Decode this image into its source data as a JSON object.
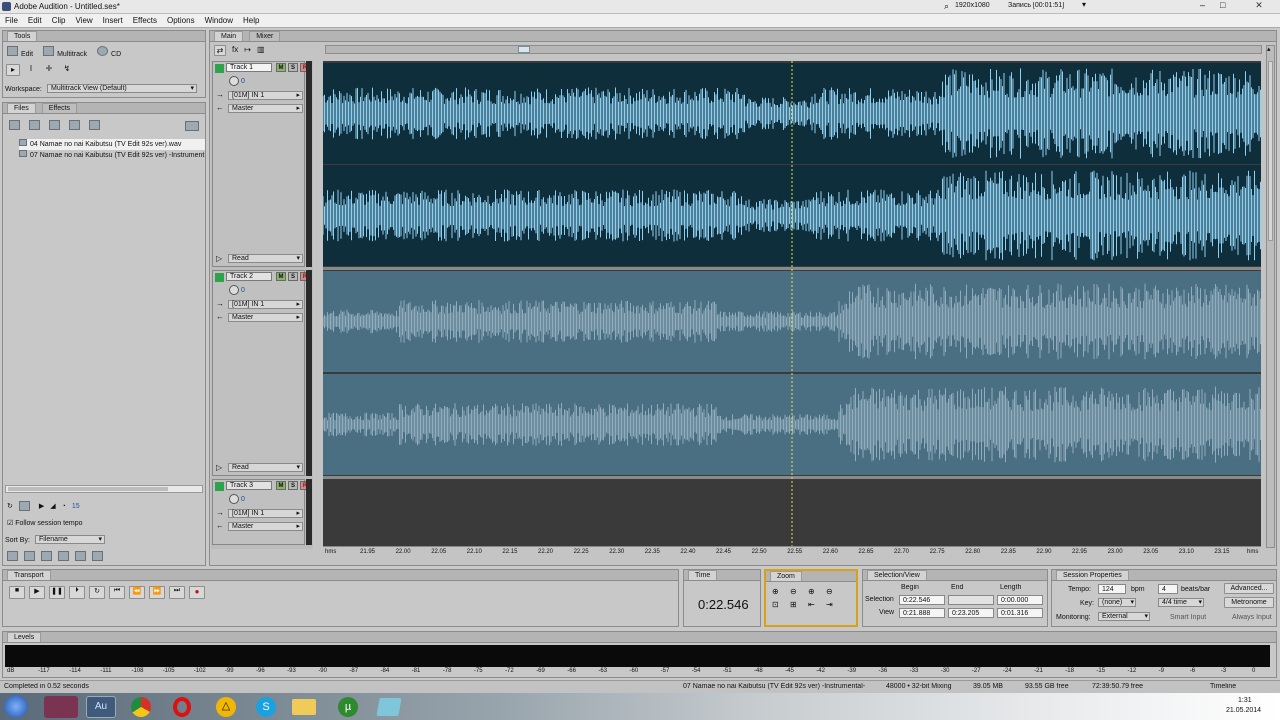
{
  "window": {
    "title": "Adobe Audition - Untitled.ses*",
    "resolution": "1920x1080",
    "record": "Запись [00:01:51]"
  },
  "menu": [
    "File",
    "Edit",
    "Clip",
    "View",
    "Insert",
    "Effects",
    "Options",
    "Window",
    "Help"
  ],
  "tools": {
    "tab": "Tools",
    "edit": "Edit",
    "multitrack": "Multitrack",
    "cd": "CD",
    "workspace_label": "Workspace:",
    "workspace_value": "Multitrack View (Default)"
  },
  "files": {
    "tab_files": "Files",
    "tab_effects": "Effects",
    "items": [
      "04 Namae no nai Kaibutsu (TV Edit 92s ver).wav",
      "07 Namae no nai Kaibutsu (TV Edit 92s ver) -Instrument"
    ],
    "follow": "Follow session tempo",
    "sortby_label": "Sort By:",
    "sortby_value": "Filename",
    "counter": "15"
  },
  "main_tabs": [
    "Main",
    "Mixer"
  ],
  "tracks": [
    {
      "name": "Track 1",
      "vol": "0",
      "input": "[01M] IN 1",
      "output": "Master",
      "mode": "Read"
    },
    {
      "name": "Track 2",
      "vol": "0",
      "input": "[01M] IN 1",
      "output": "Master",
      "mode": "Read"
    },
    {
      "name": "Track 3",
      "vol": "0",
      "input": "[01M] IN 1",
      "output": "Master",
      "mode": ""
    }
  ],
  "msr": [
    "M",
    "S",
    "R"
  ],
  "ruler": {
    "unit": "hms",
    "ticks": [
      "21.95",
      "22.00",
      "22.05",
      "22.10",
      "22.15",
      "22.20",
      "22.25",
      "22.30",
      "22.35",
      "22.40",
      "22.45",
      "22.50",
      "22.55",
      "22.60",
      "22.65",
      "22.70",
      "22.75",
      "22.80",
      "22.85",
      "22.90",
      "22.95",
      "23.00",
      "23.05",
      "23.10",
      "23.15"
    ],
    "end": "hms"
  },
  "transport": {
    "tab": "Transport"
  },
  "time": {
    "tab": "Time",
    "value": "0:22.546"
  },
  "zoom": {
    "tab": "Zoom"
  },
  "selview": {
    "tab": "Selection/View",
    "begin": "Begin",
    "end": "End",
    "length": "Length",
    "sel_label": "Selection",
    "sel_begin": "0:22.546",
    "sel_end": "",
    "sel_length": "0:00.000",
    "view_label": "View",
    "view_begin": "0:21.888",
    "view_end": "0:23.205",
    "view_length": "0:01.316"
  },
  "session": {
    "tab": "Session Properties",
    "tempo_label": "Tempo:",
    "tempo": "124",
    "bpm": "bpm",
    "beats": "4",
    "beats_label": "beats/bar",
    "advanced": "Advanced...",
    "key_label": "Key:",
    "key": "(none)",
    "time_sig": "4/4 time",
    "metronome": "Metronome",
    "monitoring_label": "Monitoring:",
    "monitoring": "External",
    "smart_input": "Smart Input",
    "always_input": "Always Input"
  },
  "levels": {
    "tab": "Levels",
    "scale": [
      "dB",
      "-117",
      "-114",
      "-111",
      "-108",
      "-105",
      "-102",
      "-99",
      "-96",
      "-93",
      "-90",
      "-87",
      "-84",
      "-81",
      "-78",
      "-75",
      "-72",
      "-69",
      "-66",
      "-63",
      "-60",
      "-57",
      "-54",
      "-51",
      "-48",
      "-45",
      "-42",
      "-39",
      "-36",
      "-33",
      "-30",
      "-27",
      "-24",
      "-21",
      "-18",
      "-15",
      "-12",
      "-9",
      "-6",
      "-3",
      "0"
    ]
  },
  "status": {
    "left": "Completed in 0.52 seconds",
    "file": "07 Namae no nai Kaibutsu (TV Edit 92s ver) -Instrumental-",
    "format": "48000 • 32-bit Mixing",
    "size": "39.05 MB",
    "free": "93.55 GB free",
    "duration": "72:39:50.79 free",
    "view": "Timeline"
  },
  "taskbar": {
    "time": "1:31",
    "date": "21.05.2014"
  },
  "colors": {
    "wave_active": "#8fd0f0",
    "wave_bg_active": "#0f2e3c",
    "wave_inactive": "#90adbd",
    "wave_bg_inactive": "#4b6f82",
    "cursor": "#e8e040"
  }
}
